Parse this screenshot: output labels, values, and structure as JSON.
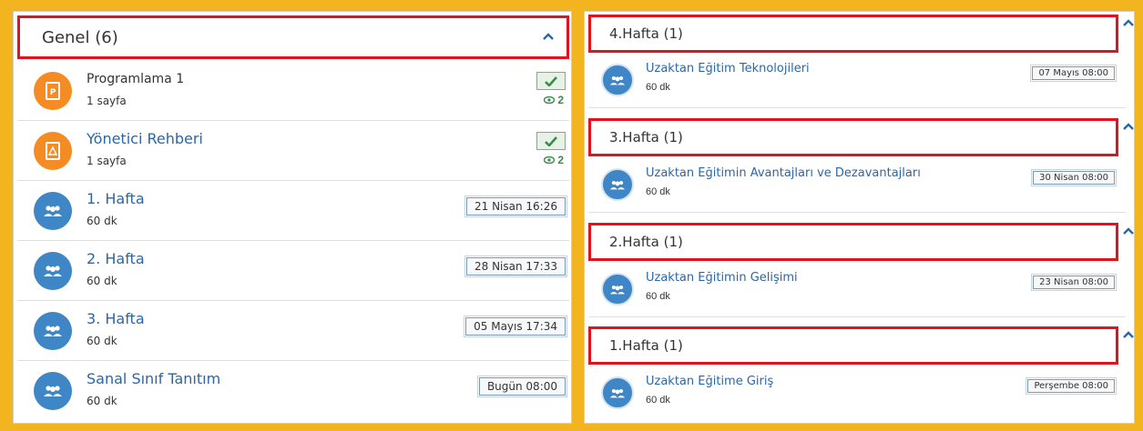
{
  "left": {
    "header": {
      "title": "Genel (6)"
    },
    "items": [
      {
        "type": "pdf",
        "title": "Programlama 1",
        "subtitle": "1 sayfa",
        "views": "2",
        "icon": "pdf-icon"
      },
      {
        "type": "pdf",
        "title": "Yönetici Rehberi",
        "subtitle": "1 sayfa",
        "views": "2",
        "icon": "pdf-icon"
      },
      {
        "type": "session",
        "title": "1. Hafta",
        "subtitle": "60 dk",
        "date": "21 Nisan 16:26",
        "icon": "people-icon"
      },
      {
        "type": "session",
        "title": "2. Hafta",
        "subtitle": "60 dk",
        "date": "28 Nisan 17:33",
        "icon": "people-icon"
      },
      {
        "type": "session",
        "title": "3. Hafta",
        "subtitle": "60 dk",
        "date": "05 Mayıs 17:34",
        "icon": "people-icon"
      },
      {
        "type": "session",
        "title": "Sanal Sınıf Tanıtım",
        "subtitle": "60 dk",
        "date": "Bugün 08:00",
        "icon": "people-icon"
      }
    ]
  },
  "right": {
    "sections": [
      {
        "title": "4.Hafta (1)",
        "item": {
          "title": "Uzaktan Eğitim Teknolojileri",
          "subtitle": "60 dk",
          "date": "07 Mayıs 08:00"
        }
      },
      {
        "title": "3.Hafta (1)",
        "item": {
          "title": "Uzaktan Eğitimin Avantajları ve Dezavantajları",
          "subtitle": "60 dk",
          "date": "30 Nisan 08:00"
        }
      },
      {
        "title": "2.Hafta (1)",
        "item": {
          "title": "Uzaktan Eğitimin Gelişimi",
          "subtitle": "60 dk",
          "date": "23 Nisan 08:00"
        }
      },
      {
        "title": "1.Hafta (1)",
        "item": {
          "title": "Uzaktan Eğitime Giriş",
          "subtitle": "60 dk",
          "date": "Perşembe 08:00"
        }
      }
    ]
  },
  "colors": {
    "background": "#f2b520",
    "highlight_border": "#e0141e",
    "link": "#2a67a8",
    "pdf_icon": "#f58b23",
    "session_icon": "#3f86c6",
    "completed_check": "#3d8a4a"
  }
}
